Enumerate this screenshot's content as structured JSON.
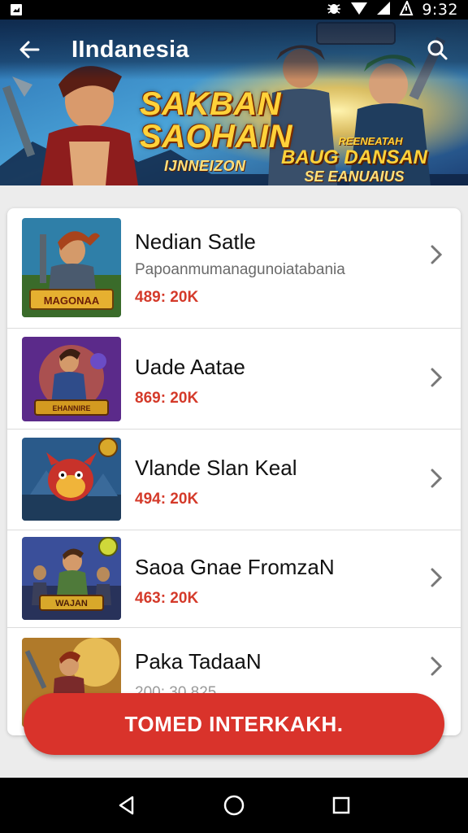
{
  "status_bar": {
    "time": "9:32",
    "icons": [
      "notification-icon",
      "bug-icon",
      "wifi-icon",
      "signal-icon",
      "battery-icon"
    ]
  },
  "app_bar": {
    "title": "IIndanesia",
    "back_icon": "arrow-left-icon",
    "search_icon": "search-icon"
  },
  "banner": {
    "title_line1": "SAKBAN",
    "title_line2": "SAOHAIN",
    "subtitle": "IJNNEIZON",
    "right_small": "REENEATAH",
    "right_big": "BAUG DANSAN",
    "right_mid": "SE EANUAIUS"
  },
  "games": [
    {
      "name": "Nedian Satle",
      "desc": "Papoanmumanagunoiatabania",
      "meta": "489: 20K",
      "thumb_label": "MAGONAA"
    },
    {
      "name": "Uade Aatae",
      "desc": "",
      "meta": "869: 20K",
      "thumb_label": "EHANNIRE"
    },
    {
      "name": "Vlande Slan Keal",
      "desc": "",
      "meta": "494: 20K",
      "thumb_label": ""
    },
    {
      "name": "Saoa Gnae FromzaN",
      "desc": "",
      "meta": "463: 20K",
      "thumb_label": "WAJAN"
    },
    {
      "name": "Paka TadaaN",
      "desc": "",
      "meta": "200: 30 825",
      "thumb_label": ""
    }
  ],
  "cta": {
    "label": "TOMED INTERKAKH."
  },
  "nav": {
    "back_icon": "triangle-back-icon",
    "home_icon": "circle-home-icon",
    "recents_icon": "square-recents-icon"
  },
  "colors": {
    "accent": "#d9332b",
    "meta": "#d43a2a",
    "status_bar": "#000000"
  }
}
